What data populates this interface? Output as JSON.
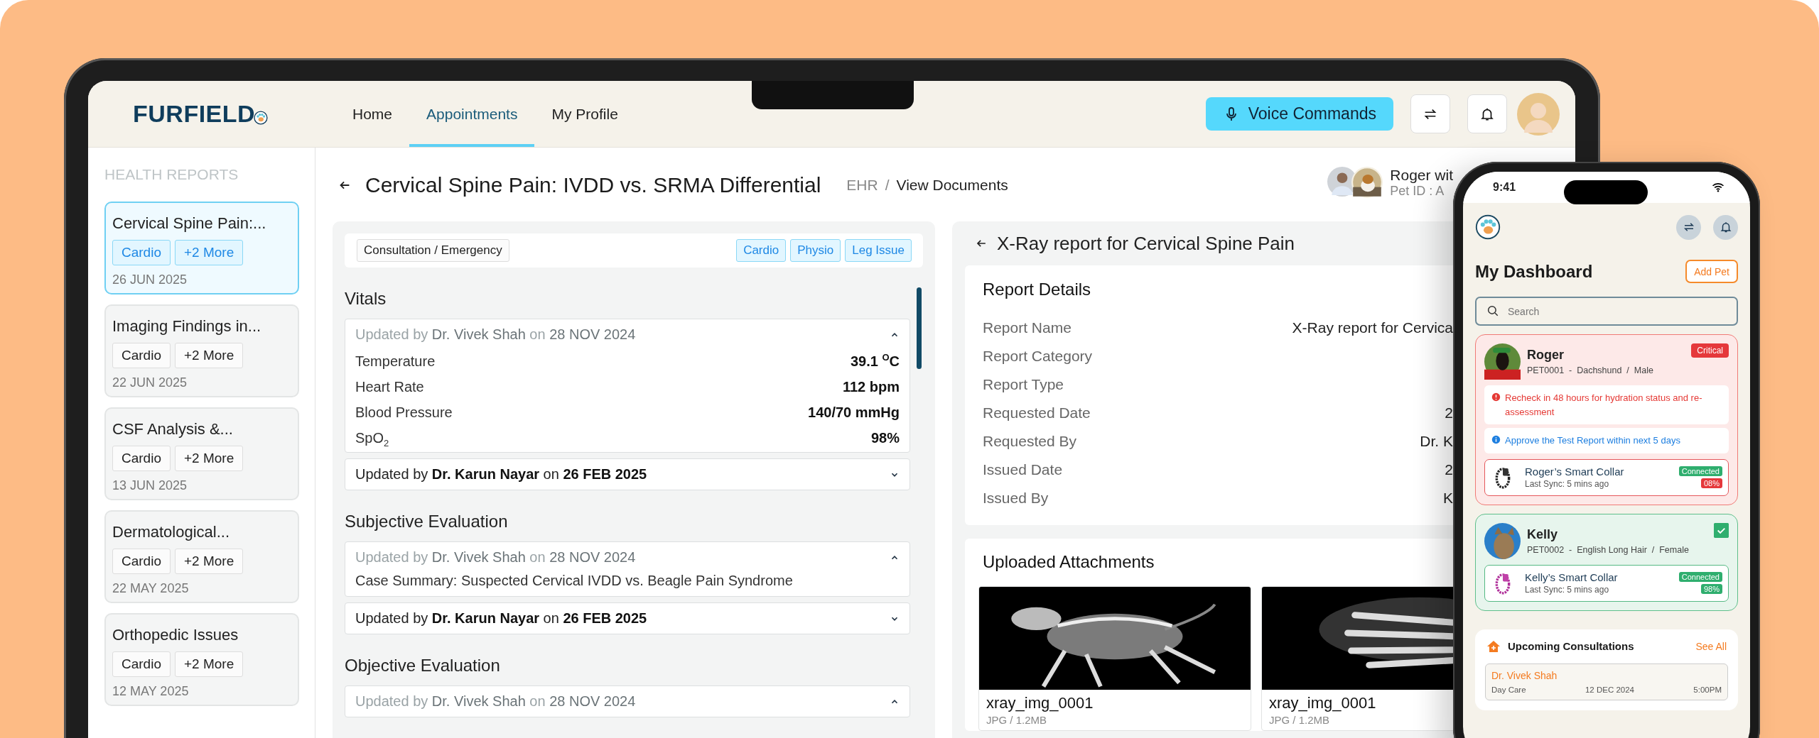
{
  "brand": {
    "name": "FURFIELD"
  },
  "nav": [
    {
      "label": "Home",
      "selected": false
    },
    {
      "label": "Appointments",
      "selected": true
    },
    {
      "label": "My Profile",
      "selected": false
    }
  ],
  "header_actions": {
    "voice_button": "Voice Commands"
  },
  "sidebar": {
    "title": "HEALTH REPORTS",
    "items": [
      {
        "title": "Cervical Spine Pain:...",
        "tags": [
          "Cardio",
          "+2 More"
        ],
        "date": "26 JUN 2025",
        "selected": true
      },
      {
        "title": "Imaging Findings in...",
        "tags": [
          "Cardio",
          "+2 More"
        ],
        "date": "22 JUN 2025",
        "selected": false
      },
      {
        "title": "CSF Analysis &...",
        "tags": [
          "Cardio",
          "+2 More"
        ],
        "date": "13 JUN 2025",
        "selected": false
      },
      {
        "title": "Dermatological...",
        "tags": [
          "Cardio",
          "+2 More"
        ],
        "date": "22 MAY 2025",
        "selected": false
      },
      {
        "title": "Orthopedic Issues",
        "tags": [
          "Cardio",
          "+2 More"
        ],
        "date": "12 MAY 2025",
        "selected": false
      }
    ]
  },
  "page": {
    "title": "Cervical Spine Pain: IVDD vs. SRMA Differential",
    "breadcrumb": [
      "EHR",
      "View Documents"
    ],
    "breadcrumb_separator": "/",
    "patient": {
      "name": "Roger wit",
      "pet_id": "Pet ID : A"
    }
  },
  "consultation": {
    "type": "Consultation / Emergency",
    "tags": [
      "Cardio",
      "Physio",
      "Leg Issue"
    ],
    "sections": [
      {
        "title": "Vitals",
        "updates": [
          {
            "header": "Updated by **Dr. Vivek Shah** on **28 NOV 2024**",
            "expanded": true,
            "rows": [
              {
                "label": "Temperature",
                "value": "39.1 $^{O}$C"
              },
              {
                "label": "Heart Rate",
                "value": "112 bpm"
              },
              {
                "label": "Blood Pressure",
                "value": "140/70 mmHg"
              },
              {
                "label": "SpO$_{2}$",
                "value": "98%"
              }
            ]
          },
          {
            "header": "Updated by **Dr. Karun Nayar** on **26 FEB 2025**",
            "expanded": false
          }
        ]
      },
      {
        "title": "Subjective Evaluation",
        "updates": [
          {
            "header": "Updated by **Dr. Vivek Shah** on **28 NOV 2024**",
            "expanded": true,
            "note": "Case Summary: Suspected Cervical IVDD vs. Beagle Pain Syndrome"
          },
          {
            "header": "Updated by **Dr. Karun Nayar** on **26 FEB 2025**",
            "expanded": false
          }
        ]
      },
      {
        "title": "Objective Evaluation",
        "updates": [
          {
            "header": "Updated by **Dr. Vivek Shah** on **28 NOV 2024**",
            "expanded": true
          }
        ]
      }
    ]
  },
  "report": {
    "title": "X-Ray report for Cervical Spine Pain",
    "details_title": "Report Details",
    "details": [
      {
        "label": "Report Name",
        "value": "X-Ray report for Cervica"
      },
      {
        "label": "Report Category"
      },
      {
        "label": "Report Type"
      },
      {
        "label": "Requested Date",
        "value": "2"
      },
      {
        "label": "Requested By",
        "value": "Dr. K"
      },
      {
        "label": "Issued Date",
        "value": "2"
      },
      {
        "label": "Issued By",
        "value": "K"
      }
    ],
    "attachments_title": "Uploaded Attachments",
    "attachments": [
      {
        "name": "xray_img_0001",
        "meta": "JPG / 1.2MB",
        "kind": "picture"
      },
      {
        "name": "xray_img_0001",
        "meta": "JPG / 1.2MB",
        "kind": "picture"
      }
    ]
  },
  "phone": {
    "time": "9:41",
    "title": "My Dashboard",
    "add_button": "Add Pet",
    "search": {
      "placeholder": "Search"
    },
    "pets": [
      {
        "name": "Roger",
        "info": "PET0001  -  Dachshund  /  Male",
        "kind": "critical",
        "badge": "Critical",
        "alerts": [
          {
            "kind": "error",
            "text": "Recheck in 48 hours for hydration status and re-assessment"
          },
          {
            "kind": "info",
            "text": "Approve the Test Report within next 5 days"
          }
        ],
        "device": {
          "name": "Roger’s Smart Collar",
          "sync": "Last Sync:  5 mins ago",
          "status": "Connected",
          "battery": "08%",
          "low": true
        }
      },
      {
        "name": "Kelly",
        "info": "PET0002  -  English Long Hair  /  Female",
        "kind": "healthy",
        "checked": true,
        "device": {
          "name": "Kelly’s Smart Collar",
          "sync": "Last Sync:  5 mins ago",
          "status": "Connected",
          "battery": "98%",
          "low": false
        }
      }
    ],
    "consultations": {
      "title": "Upcoming Consultations",
      "link": "See All",
      "items": [
        {
          "doctor": "Dr. Vivek Shah",
          "type": "Day Care",
          "date": "12 DEC 2024",
          "time": "5:00PM"
        }
      ]
    }
  }
}
